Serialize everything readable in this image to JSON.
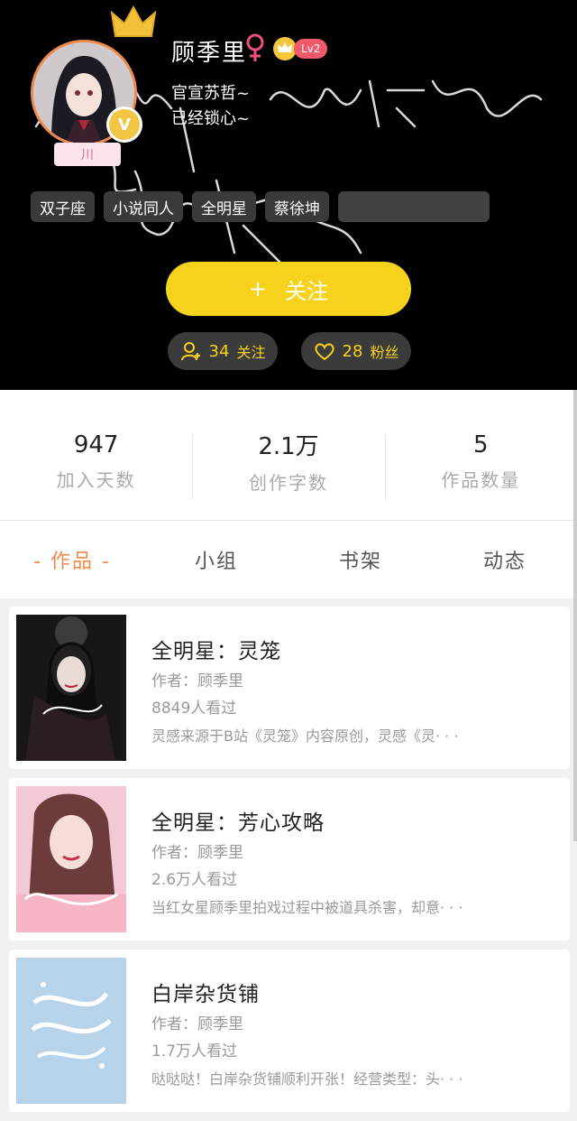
{
  "profile": {
    "name_tag": "川",
    "username": "顾季里",
    "level": "Lv2",
    "bio_line1": "官宣苏哲~",
    "bio_line2": "已经锁心~",
    "tags": [
      "双子座",
      "小说同人",
      "全明星",
      "蔡徐坤"
    ],
    "follow_button": "关注",
    "follow_button_plus": "+",
    "following_count": "34",
    "following_label": "关注",
    "fans_count": "28",
    "fans_label": "粉丝"
  },
  "stats": [
    {
      "value": "947",
      "label": "加入天数"
    },
    {
      "value": "2.1万",
      "label": "创作字数"
    },
    {
      "value": "5",
      "label": "作品数量"
    }
  ],
  "tabs": [
    {
      "label": "- 作品 -",
      "active": true
    },
    {
      "label": "小组",
      "active": false
    },
    {
      "label": "书架",
      "active": false
    },
    {
      "label": "动态",
      "active": false
    }
  ],
  "works": [
    {
      "title": "全明星：灵笼",
      "author": "作者：顾季里",
      "views": "8849人看过",
      "desc": "灵感来源于B站《灵笼》内容原创，灵感《灵· · ·"
    },
    {
      "title": "全明星：芳心攻略",
      "author": "作者：顾季里",
      "views": "2.6万人看过",
      "desc": "当红女星顾季里拍戏过程中被道具杀害，却意· · ·"
    },
    {
      "title": "白岸杂货铺",
      "author": "作者：顾季里",
      "views": "1.7万人看过",
      "desc": "哒哒哒！白岸杂货铺顺利开张！经营类型：头· · ·"
    }
  ],
  "colors": {
    "accent": "#f7d21d",
    "active_tab": "#f08a4b",
    "header_bg": "#000000"
  }
}
